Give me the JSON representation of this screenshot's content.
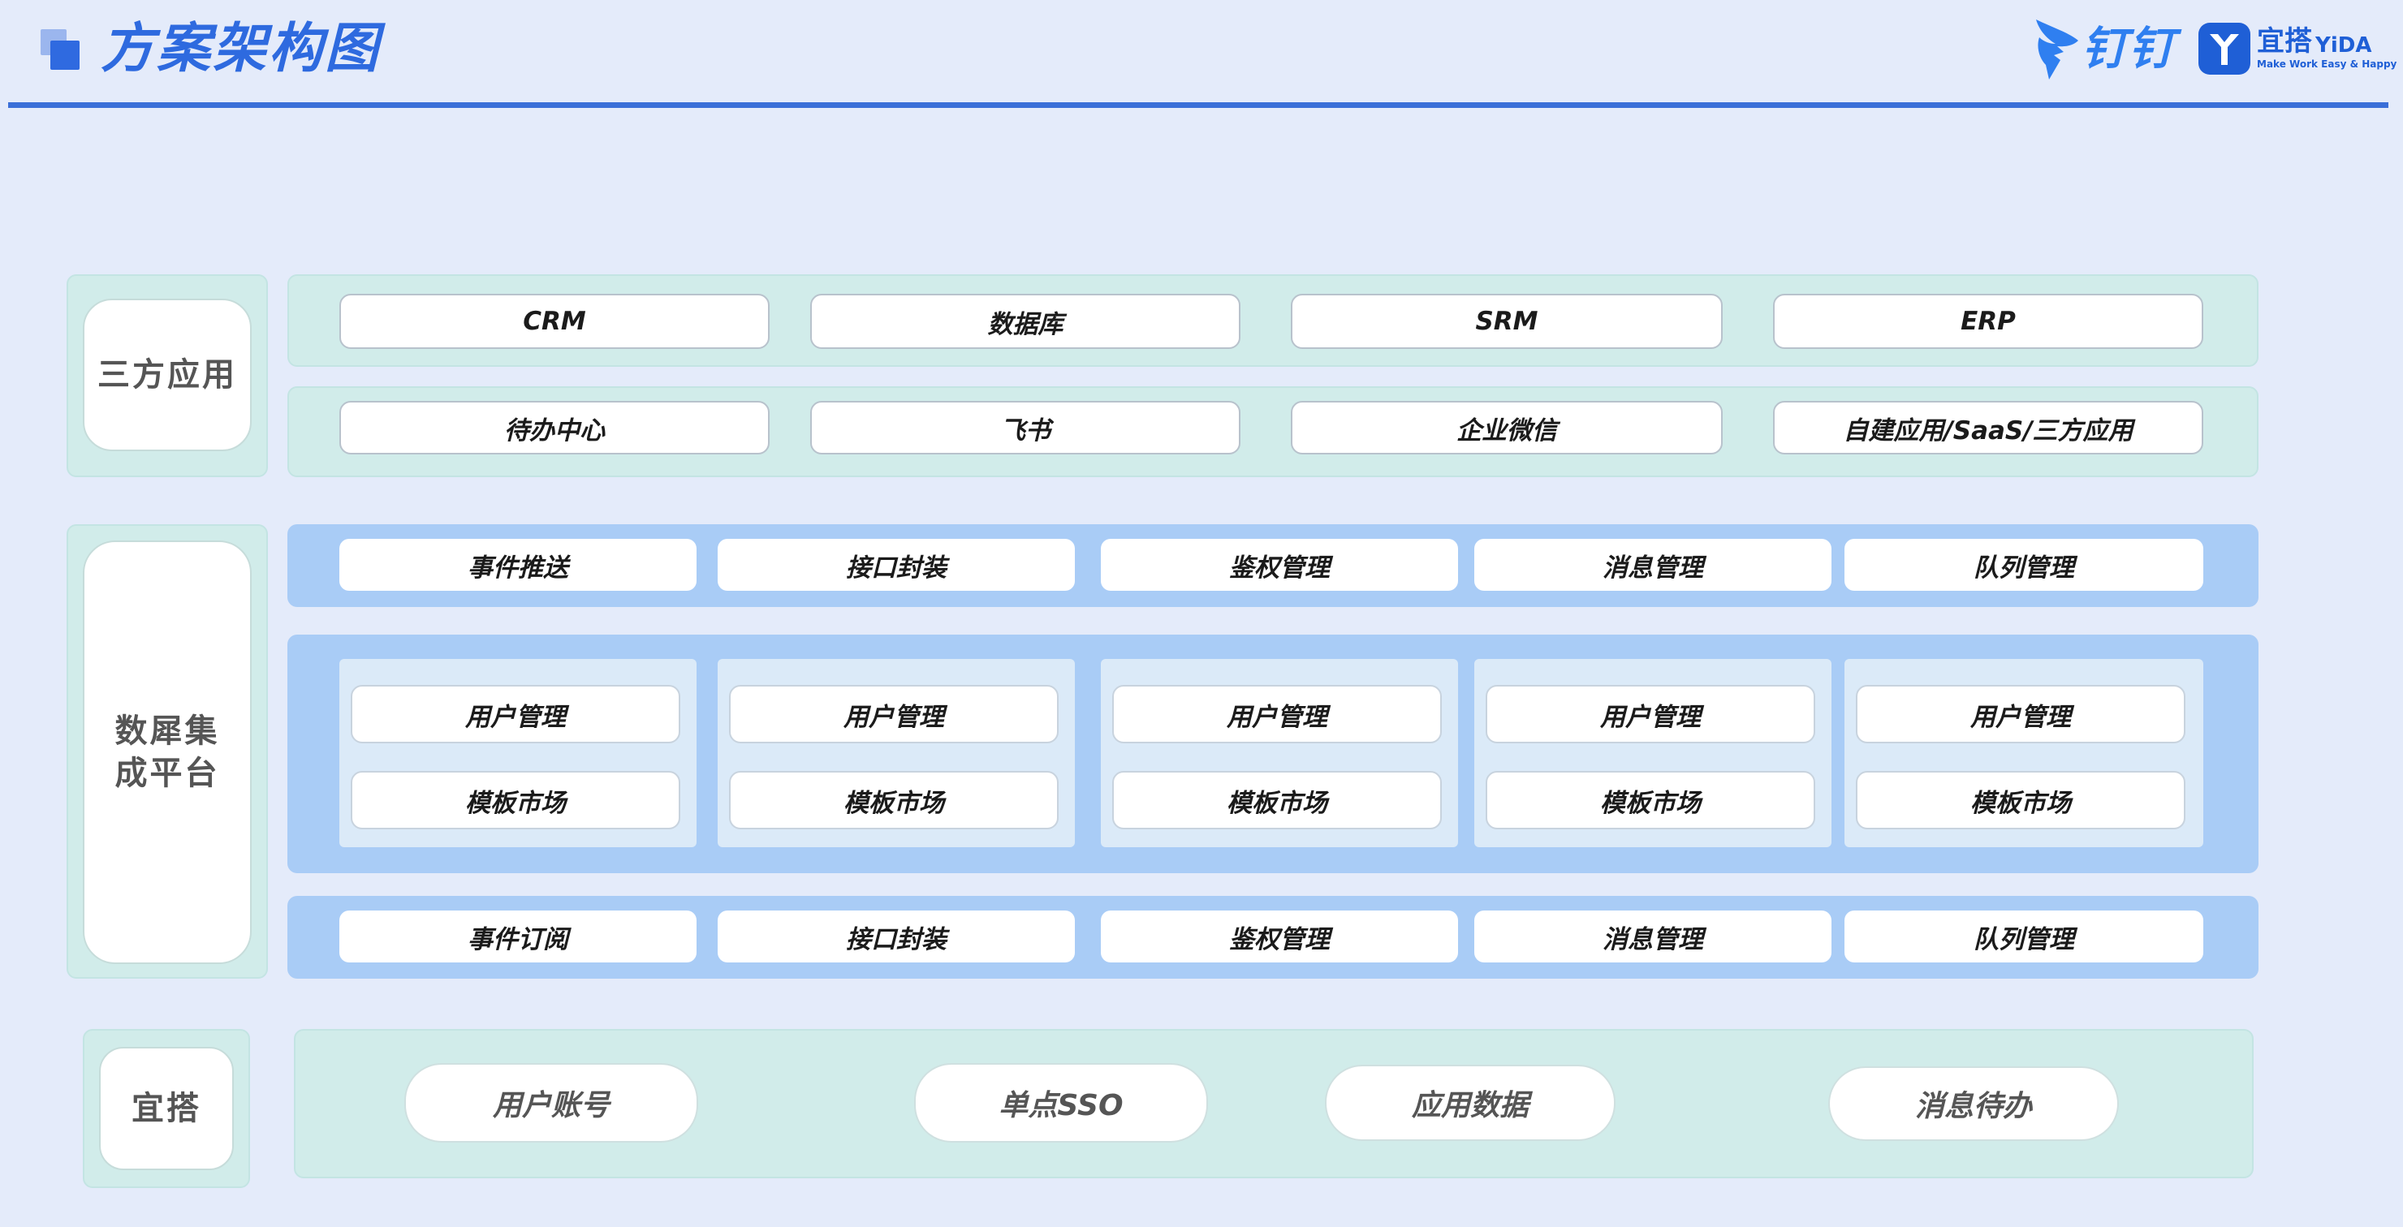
{
  "header": {
    "title": "方案架构图",
    "brand_dingtalk": "钉钉",
    "brand_yida_cn": "宜搭",
    "brand_yida_en": "YiDA",
    "brand_yida_slogan": "Make Work Easy & Happy"
  },
  "third_party": {
    "label": "三方应用",
    "row1": [
      "CRM",
      "数据库",
      "SRM",
      "ERP"
    ],
    "row2": [
      "待办中心",
      "飞书",
      "企业微信",
      "自建应用/SaaS/三方应用"
    ]
  },
  "integration": {
    "label": "数犀集成平台",
    "label_lines": [
      "数犀集",
      "成平台"
    ],
    "top_row": [
      "事件推送",
      "接口封装",
      "鉴权管理",
      "消息管理",
      "队列管理"
    ],
    "middle_groups": [
      [
        "用户管理",
        "模板市场"
      ],
      [
        "用户管理",
        "模板市场"
      ],
      [
        "用户管理",
        "模板市场"
      ],
      [
        "用户管理",
        "模板市场"
      ],
      [
        "用户管理",
        "模板市场"
      ]
    ],
    "bottom_row": [
      "事件订阅",
      "接口封装",
      "鉴权管理",
      "消息管理",
      "队列管理"
    ]
  },
  "yida": {
    "label": "宜搭",
    "items": [
      "用户账号",
      "单点SSO",
      "应用数据",
      "消息待办"
    ]
  },
  "colors": {
    "background": "#e4ebfa",
    "title_blue": "#2e6adf",
    "rule_blue": "#3a6fd8",
    "panel_green": "#d1ecea",
    "panel_blue": "#a9ccf6",
    "panel_inner": "#dbeaf8"
  },
  "icons": [
    "dingtalk-logo-icon",
    "yida-logo-icon",
    "title-squares-icon"
  ]
}
